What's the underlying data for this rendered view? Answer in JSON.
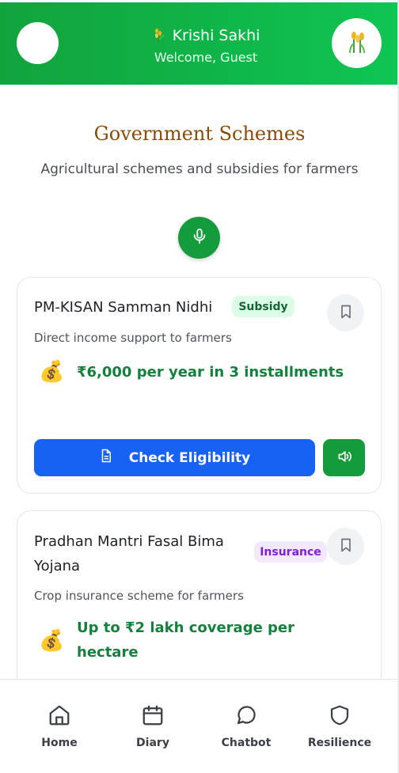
{
  "header": {
    "title": "Krishi Sakhi",
    "subtitle": "Welcome, Guest",
    "logo_icon": "wheat-icon"
  },
  "page": {
    "title": "Government Schemes",
    "subtitle": "Agricultural schemes and subsidies for farmers"
  },
  "voice": {
    "icon": "microphone-icon"
  },
  "schemes": [
    {
      "title": "PM-KISAN Samman Nidhi",
      "badge": "Subsidy",
      "description": "Direct income support to farmers",
      "benefit": "₹6,000 per year in 3 installments",
      "benefit_icon": "money-bag-icon",
      "action_label": "Check Eligibility"
    },
    {
      "title_line1": "Pradhan Mantri Fasal Bima",
      "title_line2": "Yojana",
      "badge": "Insurance",
      "description": "Crop insurance scheme for farmers",
      "benefit_line1": "Up to ₹2 lakh coverage per",
      "benefit_line2": "hectare",
      "benefit_icon": "money-bag-icon"
    }
  ],
  "nav": {
    "items": [
      {
        "label": "Home",
        "icon": "home-icon"
      },
      {
        "label": "Diary",
        "icon": "calendar-icon"
      },
      {
        "label": "Chatbot",
        "icon": "chat-bubble-icon"
      },
      {
        "label": "Resilience",
        "icon": "shield-icon"
      }
    ]
  },
  "colors": {
    "header_green": "#12a33d",
    "primary_blue": "#1762f5",
    "action_green": "#149b3b",
    "title_brown": "#8a4b07",
    "benefit_green": "#15803d"
  }
}
